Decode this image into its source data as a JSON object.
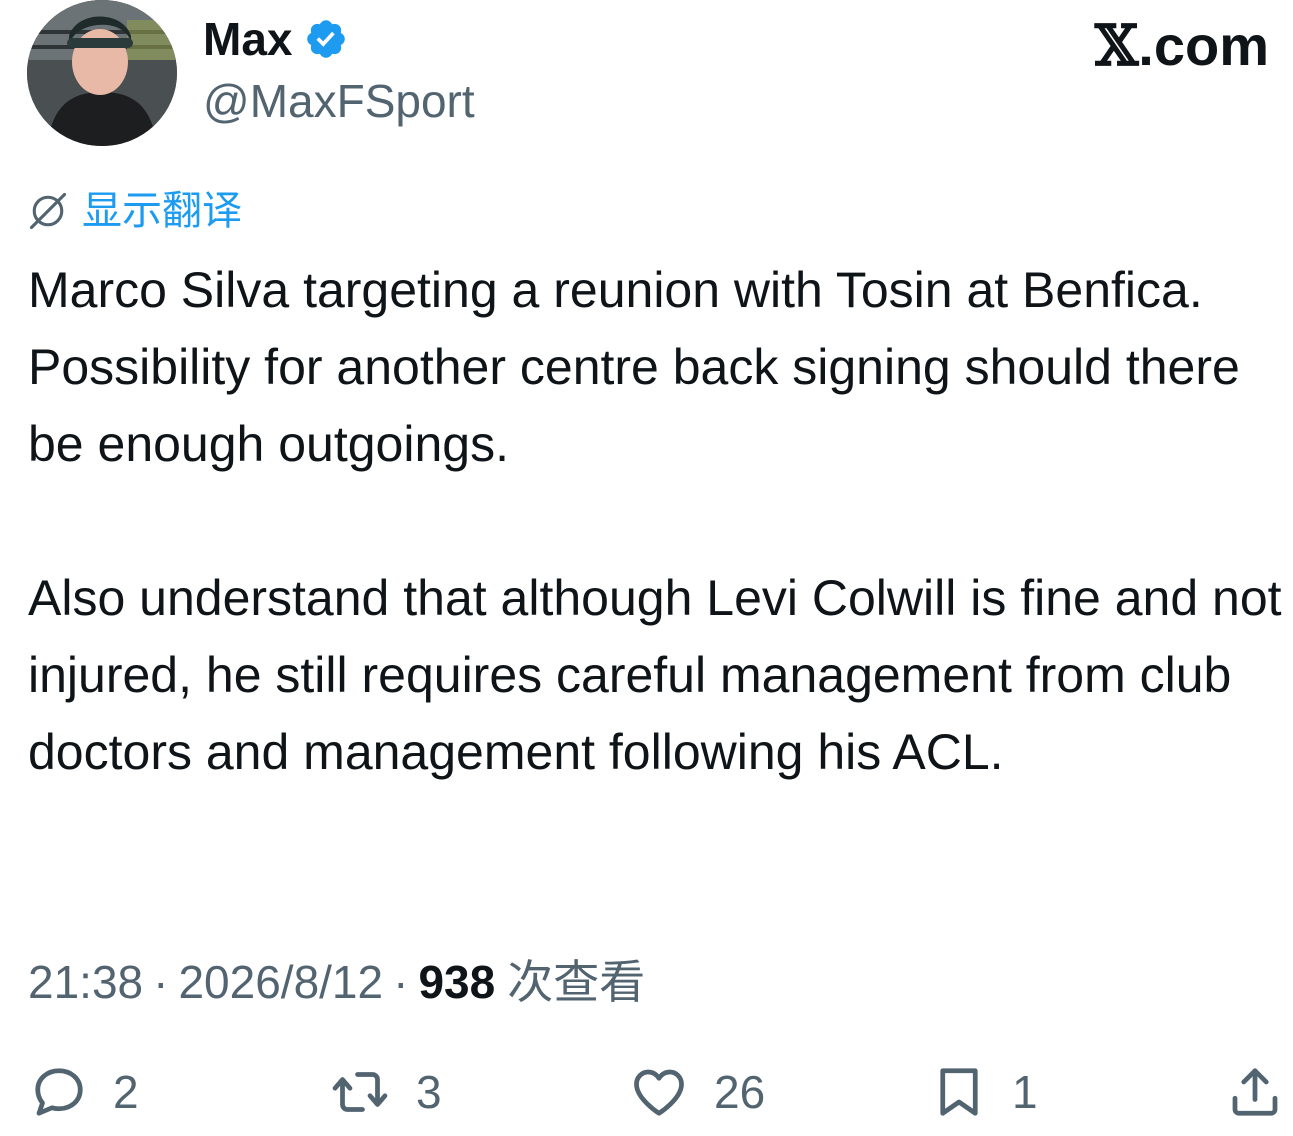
{
  "author": {
    "display_name": "Max",
    "handle": "@MaxFSport",
    "verified": true,
    "verified_color": "#1d9bf0"
  },
  "brand": {
    "x_glyph": "𝕏",
    "suffix": ".com"
  },
  "translate": {
    "icon": "globe-slash-icon",
    "label": "显示翻译",
    "color": "#1d9bf0"
  },
  "tweet": {
    "paragraphs": [
      "Marco Silva targeting a reunion with Tosin at Benfica. Possibility for another centre back signing should there be enough outgoings.",
      "Also understand that although Levi Colwill is fine and not injured, he still requires careful management from club doctors and management following his ACL."
    ]
  },
  "meta": {
    "time": "21:38",
    "separator": "·",
    "date": "2026/8/12",
    "views_count": "938",
    "views_label": "次查看"
  },
  "actions": {
    "reply": {
      "icon": "reply-bubble-icon",
      "count": "2"
    },
    "retweet": {
      "icon": "retweet-icon",
      "count": "3"
    },
    "like": {
      "icon": "heart-icon",
      "count": "26"
    },
    "bookmark": {
      "icon": "bookmark-icon",
      "count": "1"
    },
    "share": {
      "icon": "share-icon"
    }
  },
  "colors": {
    "text_primary": "#0f1419",
    "text_secondary": "#536471",
    "accent": "#1d9bf0"
  }
}
